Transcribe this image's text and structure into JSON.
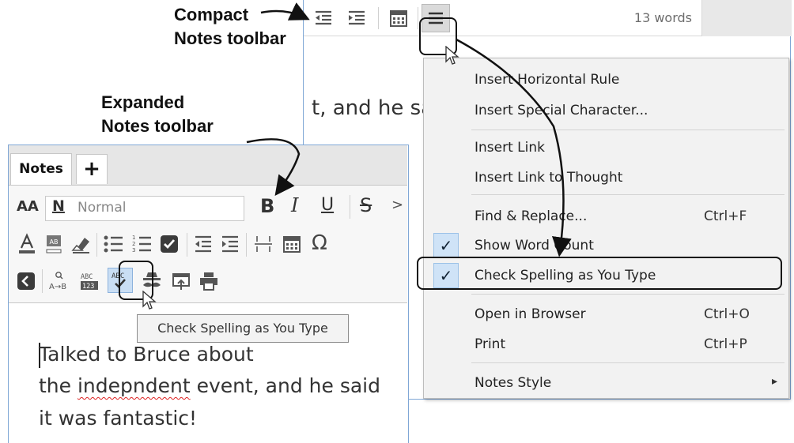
{
  "annotations": {
    "compact_line1": "Compact",
    "compact_line2": "Notes toolbar",
    "expanded_line1": "Expanded",
    "expanded_line2": "Notes toolbar"
  },
  "compact": {
    "word_count": "13 words",
    "body_text": "t, and he sa",
    "toolbar_icons": [
      "outdent-icon",
      "indent-icon",
      "calendar-icon",
      "hamburger-menu-icon"
    ]
  },
  "menu": {
    "items": [
      {
        "label": "Insert Horizontal Rule",
        "shortcut": ""
      },
      {
        "label": "Insert Special Character...",
        "shortcut": ""
      },
      {
        "label": "Insert Link",
        "shortcut": ""
      },
      {
        "label": "Insert Link to Thought",
        "shortcut": ""
      },
      {
        "label": "Find & Replace...",
        "shortcut": "Ctrl+F"
      },
      {
        "label": "Show Word Count",
        "shortcut": "",
        "checked": true
      },
      {
        "label": "Check Spelling as You Type",
        "shortcut": "",
        "checked": true
      },
      {
        "label": "Open in Browser",
        "shortcut": "Ctrl+O"
      },
      {
        "label": "Print",
        "shortcut": "Ctrl+P"
      },
      {
        "label": "Notes Style",
        "shortcut": "",
        "submenu": true
      }
    ],
    "check_glyph": "✓",
    "submenu_glyph": "▸"
  },
  "expanded": {
    "tab_label": "Notes",
    "add_tab_label": "+",
    "font_size_label": "AA",
    "style_icon_label": "N",
    "style_value": "Normal",
    "bold_label": "B",
    "italic_label": "I",
    "underline_label": "U",
    "strike_label": "S",
    "more_label": ">",
    "omega_label": "Ω",
    "tooltip": "Check Spelling as You Type",
    "body_lines": [
      "Talked to Bruce about",
      "the ",
      "indepndent",
      " event, and he said",
      "it was fantastic!"
    ]
  },
  "colors": {
    "window_border": "#7fa7d6",
    "menu_bg": "#f2f2f2",
    "check_bg": "#cfe3f7",
    "spell_error": "#dd2222"
  }
}
